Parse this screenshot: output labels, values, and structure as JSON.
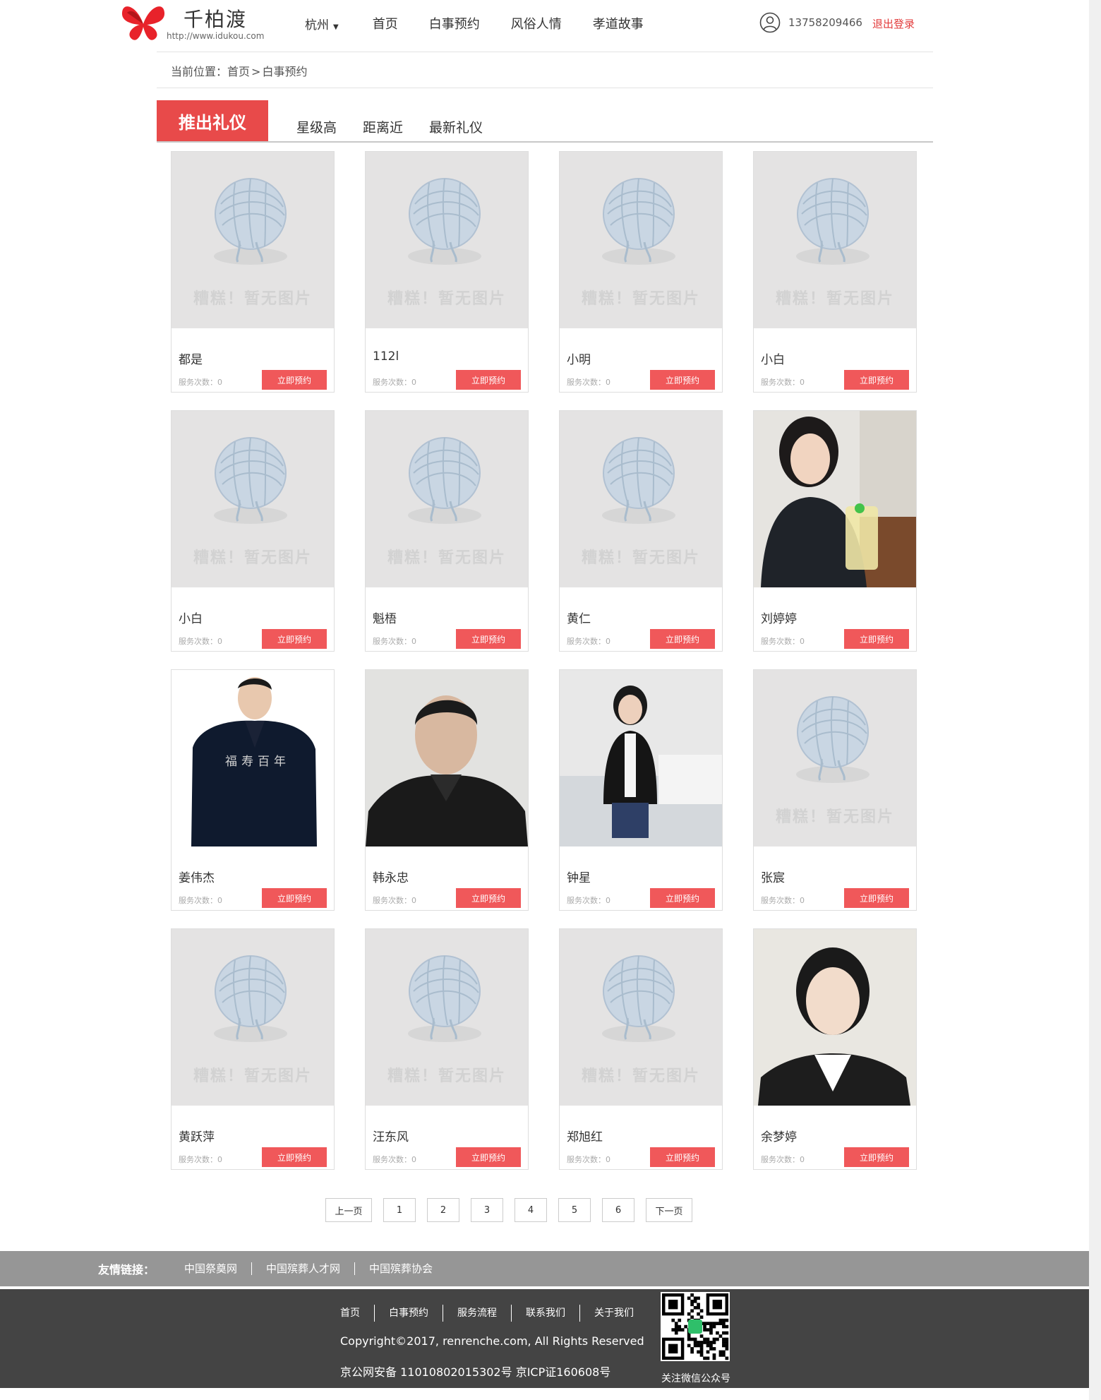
{
  "header": {
    "brand_name": "千柏渡",
    "brand_url": "http://www.idukou.com",
    "city": "杭州",
    "nav": [
      "首页",
      "白事预约",
      "风俗人情",
      "孝道故事"
    ],
    "phone": "13758209466",
    "logout": "退出登录"
  },
  "breadcrumb": {
    "prefix": "当前位置：",
    "home": "首页",
    "separator": ">",
    "current": "白事预约"
  },
  "tabs": {
    "active": "推出礼仪",
    "items": [
      "星级高",
      "距离近",
      "最新礼仪"
    ]
  },
  "placeholder_text": "糟糕！暂无图片",
  "book_label": "立即预约",
  "count_prefix": "服务次数：",
  "cards": [
    {
      "name": "都是",
      "count": "0",
      "photo": "placeholder"
    },
    {
      "name": "112l",
      "count": "0",
      "photo": "placeholder"
    },
    {
      "name": "小明",
      "count": "0",
      "photo": "placeholder"
    },
    {
      "name": "小白",
      "count": "0",
      "photo": "placeholder"
    },
    {
      "name": "小白",
      "count": "0",
      "photo": "placeholder"
    },
    {
      "name": "魁梧",
      "count": "0",
      "photo": "placeholder"
    },
    {
      "name": "黄仁",
      "count": "0",
      "photo": "placeholder"
    },
    {
      "name": "刘婷婷",
      "count": "0",
      "photo": "woman-casual"
    },
    {
      "name": "姜伟杰",
      "count": "0",
      "photo": "man-suit",
      "photo_caption": "福寿百年"
    },
    {
      "name": "韩永忠",
      "count": "0",
      "photo": "man-portrait"
    },
    {
      "name": "钟星",
      "count": "0",
      "photo": "woman-standing"
    },
    {
      "name": "张宸",
      "count": "0",
      "photo": "placeholder"
    },
    {
      "name": "黄跃萍",
      "count": "0",
      "photo": "placeholder"
    },
    {
      "name": "汪东风",
      "count": "0",
      "photo": "placeholder"
    },
    {
      "name": "郑旭红",
      "count": "0",
      "photo": "placeholder"
    },
    {
      "name": "余梦婷",
      "count": "0",
      "photo": "woman-id"
    }
  ],
  "pagination": {
    "prev": "上一页",
    "pages": [
      "1",
      "2",
      "3",
      "4",
      "5",
      "6"
    ],
    "next": "下一页"
  },
  "friend_links": {
    "title": "友情链接：",
    "items": [
      "中国祭奠网",
      "中国殡葬人才网",
      "中国殡葬协会"
    ]
  },
  "footer": {
    "nav": [
      "首页",
      "白事预约",
      "服务流程",
      "联系我们",
      "关于我们"
    ],
    "copyright": "Copyright©2017, renrenche.com, All Rights Reserved",
    "icp": "京公网安备 11010802015302号 京ICP证160608号",
    "qr_label": "关注微信公众号"
  },
  "colors": {
    "accent": "#e84a4a",
    "button": "#f0585a",
    "footer_bg": "#444444",
    "friend_bg": "#969696"
  }
}
